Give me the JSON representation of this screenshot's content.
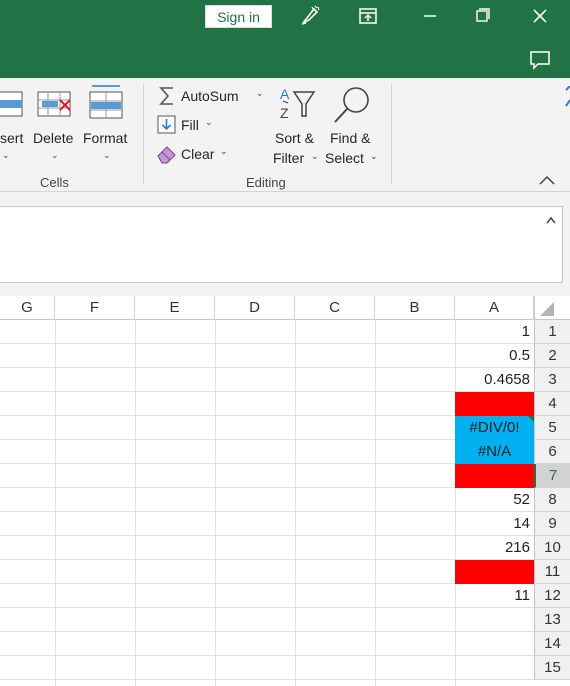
{
  "titlebar": {
    "signin_label": "Sign in",
    "icons": [
      "pen-icon",
      "restore-ribbon-icon",
      "minimize-icon",
      "maximize-icon",
      "close-icon",
      "comment-icon"
    ]
  },
  "ribbon": {
    "cells_group": {
      "label": "Cells",
      "insert_label": "sert",
      "delete_label": "Delete",
      "format_label": "Format"
    },
    "editing_group": {
      "label": "Editing",
      "autosum_label": "AutoSum",
      "fill_label": "Fill",
      "clear_label": "Clear",
      "sort_label_1": "Sort &",
      "sort_label_2": "Filter",
      "find_label_1": "Find &",
      "find_label_2": "Select"
    }
  },
  "sheet": {
    "columns": [
      "G",
      "F",
      "E",
      "D",
      "C",
      "B",
      "A"
    ],
    "rows": [
      "1",
      "2",
      "3",
      "4",
      "5",
      "6",
      "7",
      "8",
      "9",
      "10",
      "11",
      "12",
      "13",
      "14",
      "15"
    ],
    "selected_row": "7",
    "colA": [
      "1",
      "0.5",
      "0.4658",
      "",
      "#DIV/0!",
      "#N/A",
      "",
      "52",
      "14",
      "216",
      "",
      "11",
      "",
      "",
      ""
    ],
    "fills": {
      "red": "#ff0000",
      "blue": "#00b0f0",
      "accent": "#217346"
    }
  }
}
